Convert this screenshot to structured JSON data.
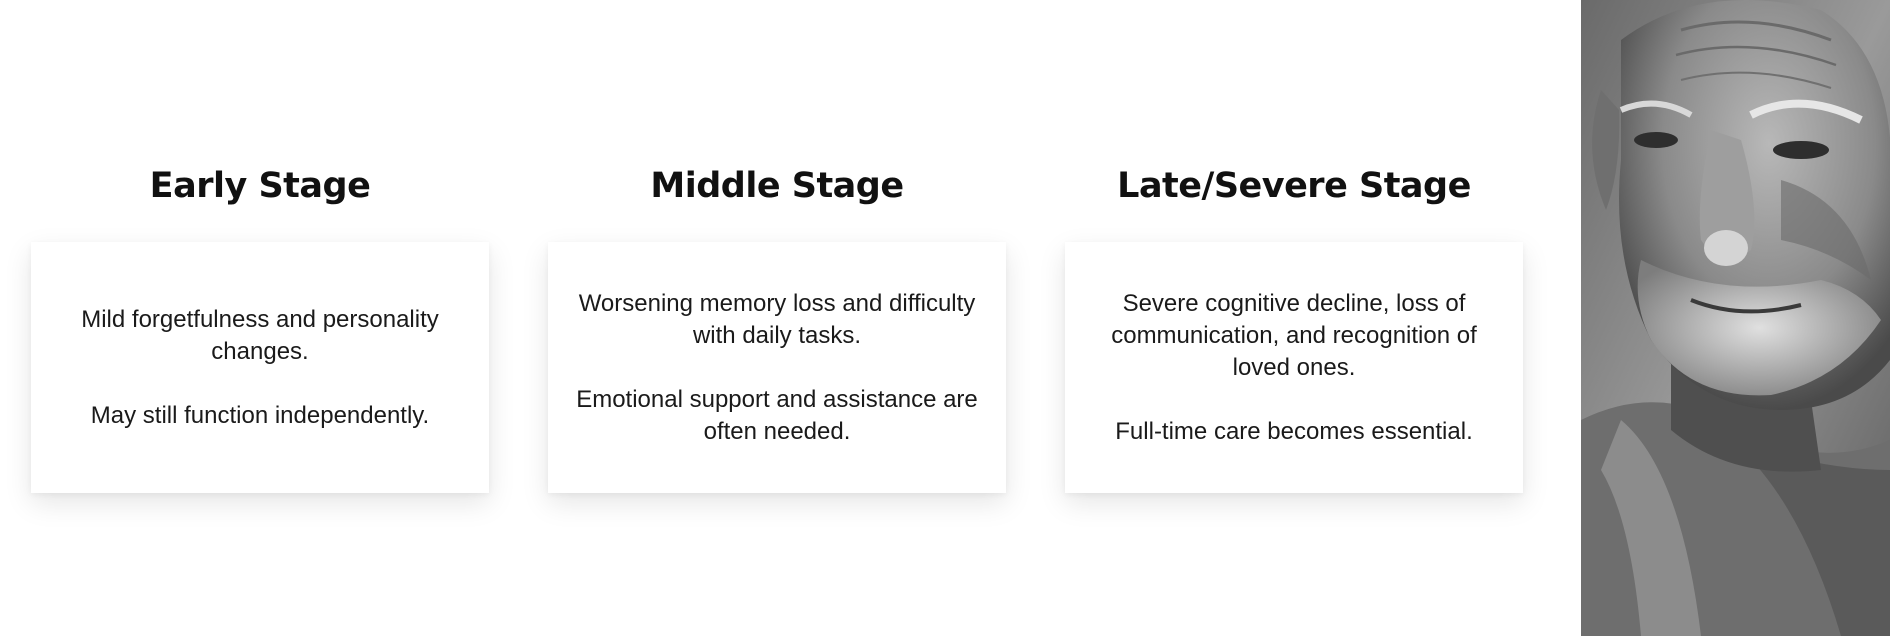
{
  "stages": [
    {
      "title": "Early Stage",
      "paragraphs": [
        "Mild forgetfulness and personality changes.",
        "May still function independently."
      ]
    },
    {
      "title": "Middle Stage",
      "paragraphs": [
        "Worsening memory loss and difficulty with daily tasks.",
        "Emotional support and assistance are often needed."
      ]
    },
    {
      "title": "Late/Severe Stage",
      "paragraphs": [
        "Severe cognitive decline, loss of communication, and recognition of loved ones.",
        "Full-time care becomes essential."
      ]
    }
  ]
}
